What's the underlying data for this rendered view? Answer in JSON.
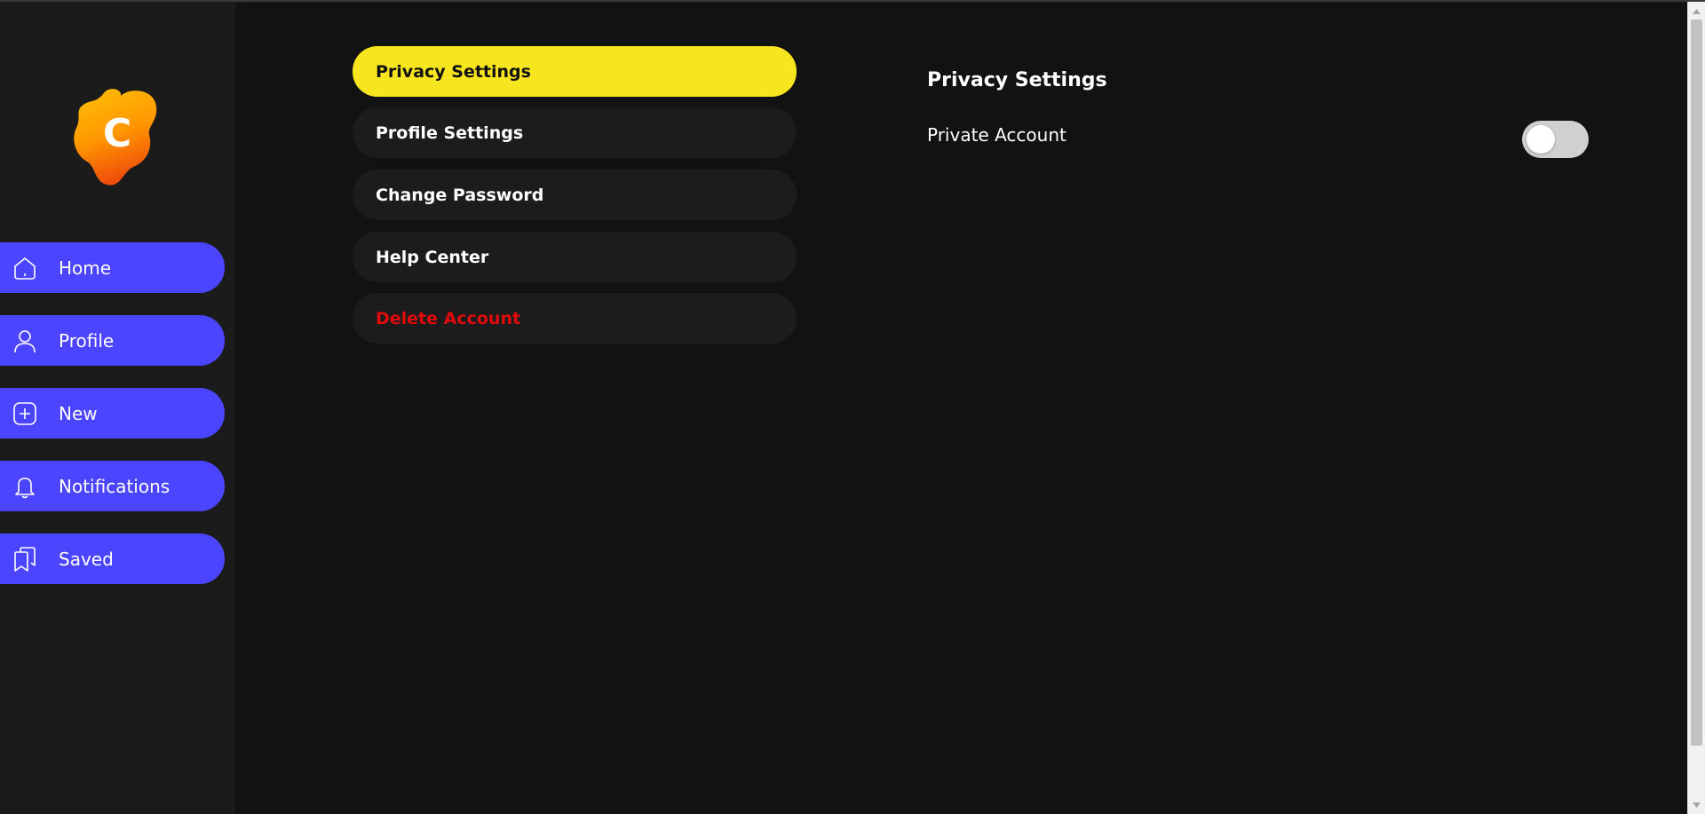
{
  "sidebar": {
    "logo_letter": "C",
    "items": [
      {
        "label": "Home",
        "icon": "home-icon"
      },
      {
        "label": "Profile",
        "icon": "user-icon"
      },
      {
        "label": "New",
        "icon": "plus-square-icon"
      },
      {
        "label": "Notifications",
        "icon": "bell-icon"
      },
      {
        "label": "Saved",
        "icon": "bookmarks-icon"
      }
    ]
  },
  "settings_menu": {
    "items": [
      {
        "label": "Privacy Settings",
        "state": "active"
      },
      {
        "label": "Profile Settings"
      },
      {
        "label": "Change Password"
      },
      {
        "label": "Help Center"
      },
      {
        "label": "Delete Account",
        "state": "danger"
      }
    ]
  },
  "panel": {
    "title": "Privacy Settings",
    "private_account_label": "Private Account",
    "private_account_enabled": false
  },
  "colors": {
    "sidebar_bg": "#1b1b1b",
    "page_bg": "#121212",
    "nav_accent": "#4b45ff",
    "active_menu": "#f7e61f",
    "danger": "#e0090b",
    "menu_bg": "#1c1c1c",
    "toggle_off": "#d0d0d0"
  }
}
